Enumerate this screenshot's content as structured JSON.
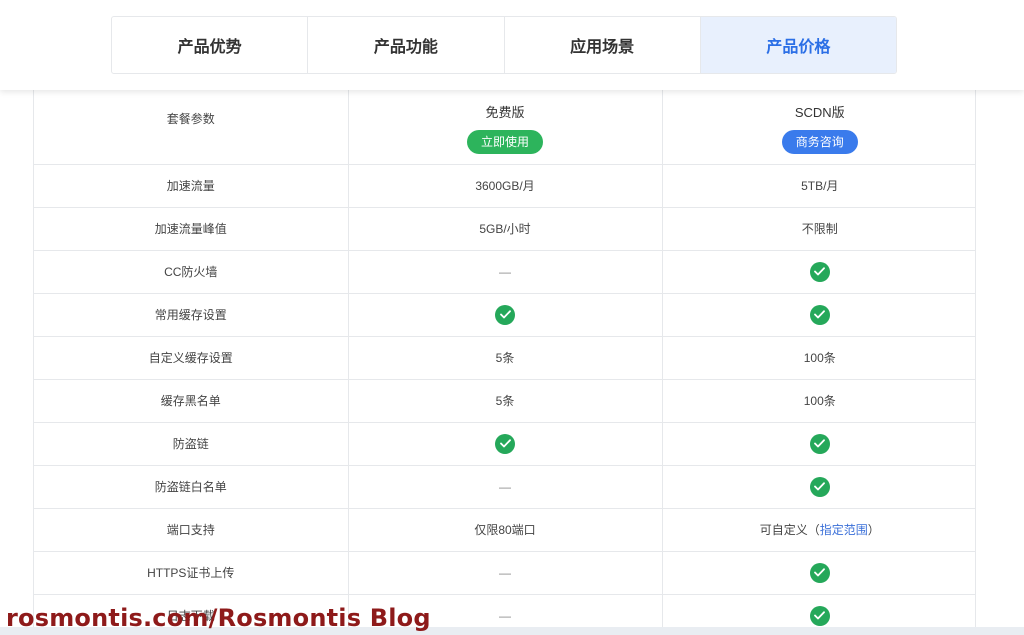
{
  "tabs": [
    {
      "label": "产品优势"
    },
    {
      "label": "产品功能"
    },
    {
      "label": "应用场景"
    },
    {
      "label": "产品价格",
      "active": true
    }
  ],
  "table": {
    "header": {
      "label": "套餐参数",
      "plans": [
        {
          "name": "免费版",
          "button": "立即使用",
          "button_color": "#2db45c"
        },
        {
          "name": "SCDN版",
          "button": "商务咨询",
          "button_color": "#3a7bec"
        }
      ]
    },
    "rows": [
      {
        "label": "加速流量",
        "free": "3600GB/月",
        "scdn": "5TB/月"
      },
      {
        "label": "加速流量峰值",
        "free": "5GB/小时",
        "scdn": "不限制"
      },
      {
        "label": "CC防火墙",
        "free": "—",
        "scdn": "check"
      },
      {
        "label": "常用缓存设置",
        "free": "check",
        "scdn": "check"
      },
      {
        "label": "自定义缓存设置",
        "free": "5条",
        "scdn": "100条"
      },
      {
        "label": "缓存黑名单",
        "free": "5条",
        "scdn": "100条"
      },
      {
        "label": "防盗链",
        "free": "check",
        "scdn": "check"
      },
      {
        "label": "防盗链白名单",
        "free": "—",
        "scdn": "check"
      },
      {
        "label": "端口支持",
        "free": "仅限80端口",
        "scdn": "可自定义（",
        "scdn_link": "指定范围",
        "scdn_suffix": "）"
      },
      {
        "label": "HTTPS证书上传",
        "free": "—",
        "scdn": "check"
      },
      {
        "label": "日志下载",
        "free": "—",
        "scdn": "check"
      }
    ]
  },
  "check_color": "#25a85a",
  "accent_color": "#2b6fe6",
  "watermark": "rosmontis.com/Rosmontis  Blog"
}
